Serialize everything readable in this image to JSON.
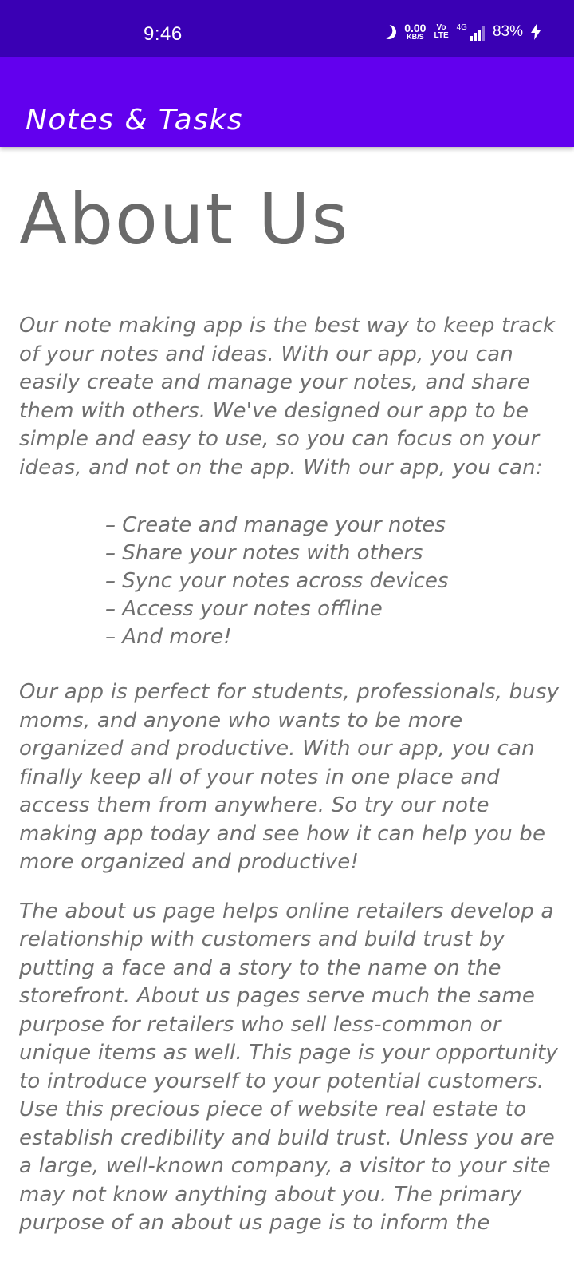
{
  "status_bar": {
    "time": "9:46",
    "net_speed_value": "0.00",
    "net_speed_unit": "KB/S",
    "volte_top": "Vo",
    "volte_bottom": "LTE",
    "network_type": "4G",
    "battery": "83%",
    "icons": [
      "moon-icon",
      "signal-icon",
      "charging-bolt-icon"
    ]
  },
  "app_bar": {
    "title": "Notes & Tasks",
    "color": "#6200ee"
  },
  "content": {
    "heading": "About Us",
    "paragraph_1": "Our note making app is the best way to keep track of your notes and ideas. With our app, you can easily create and manage your notes, and share them with others. We've designed our app to be simple and easy to use, so you can focus on your ideas, and not on the app. With our app, you can:",
    "features": [
      "Create and manage your notes",
      "Share your notes with others",
      "Sync your notes across devices",
      "Access your notes offline",
      "And more!"
    ],
    "paragraph_2": "Our app is perfect for students, professionals, busy moms, and anyone who wants to be more organized and productive. With our app, you can finally keep all of your notes in one place and access them from anywhere. So try our note making app today and see how it can help you be more organized and productive!",
    "paragraph_3": "The about us page helps online retailers develop a relationship with customers and build trust by putting a face and a story to the name on the storefront. About us pages serve much the same purpose for retailers who sell less-common or unique items as well. This page is your opportunity to introduce yourself to your potential customers. Use this precious piece of website real estate to establish credibility and build trust. Unless you are a large, well-known company, a visitor to your site may not know anything about you. The primary purpose of an about us page is to inform the"
  }
}
